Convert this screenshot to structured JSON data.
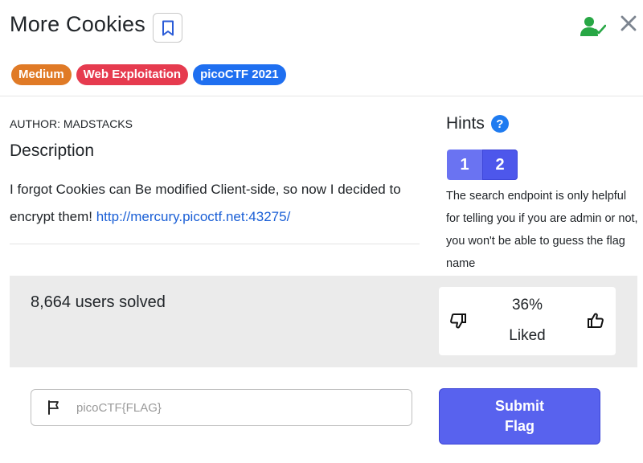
{
  "challenge": {
    "title": "More Cookies",
    "tags": {
      "difficulty": "Medium",
      "category": "Web Exploitation",
      "event": "picoCTF 2021"
    }
  },
  "description": {
    "author": "AUTHOR: MADSTACKS",
    "heading": "Description",
    "text": "I forgot Cookies can Be modified Client-side, so now I decided to encrypt them! ",
    "link": "http://mercury.picoctf.net:43275/"
  },
  "hints": {
    "heading": "Hints",
    "help_symbol": "?",
    "tabs": [
      "1",
      "2"
    ],
    "active_tab": "2",
    "text": "The search endpoint is only helpful for telling you if you are admin or not, you won't be able to guess the flag name"
  },
  "stats": {
    "solved": "8,664 users solved",
    "liked_percent": "36%",
    "liked_label": "Liked"
  },
  "submit": {
    "placeholder": "picoCTF{FLAG}",
    "value": "",
    "button_line1": "Submit",
    "button_line2": "Flag"
  },
  "colors": {
    "difficulty": "#e07a26",
    "category": "#e63b4f",
    "event": "#1f6ff0",
    "accent": "#5862ee",
    "solved_icon": "#28a745"
  },
  "icons": {
    "bookmark": "bookmark-icon",
    "user_check": "user-check-icon",
    "close": "close-icon",
    "help": "help-icon",
    "thumb_down": "thumbs-down-icon",
    "thumb_up": "thumbs-up-icon",
    "flag": "flag-icon"
  }
}
